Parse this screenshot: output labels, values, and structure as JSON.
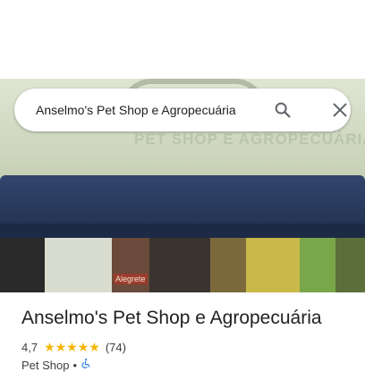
{
  "search": {
    "query": "Anselmo's Pet Shop e Agropecuária"
  },
  "hero": {
    "sign_text": "PET SHOP E AGROPECUÁRIA",
    "shop_item_label": "Alegrete"
  },
  "place": {
    "name": "Anselmo's Pet Shop e Agropecuária",
    "rating": "4,7",
    "stars": "★★★★★",
    "rating_value": 4.7,
    "review_count": "(74)",
    "category": "Pet Shop",
    "separator": "•",
    "accessibility_icon": "wheelchair-icon"
  },
  "colors": {
    "star": "#f4b400",
    "accent": "#1a73e8",
    "awning": "#2a3b60"
  }
}
